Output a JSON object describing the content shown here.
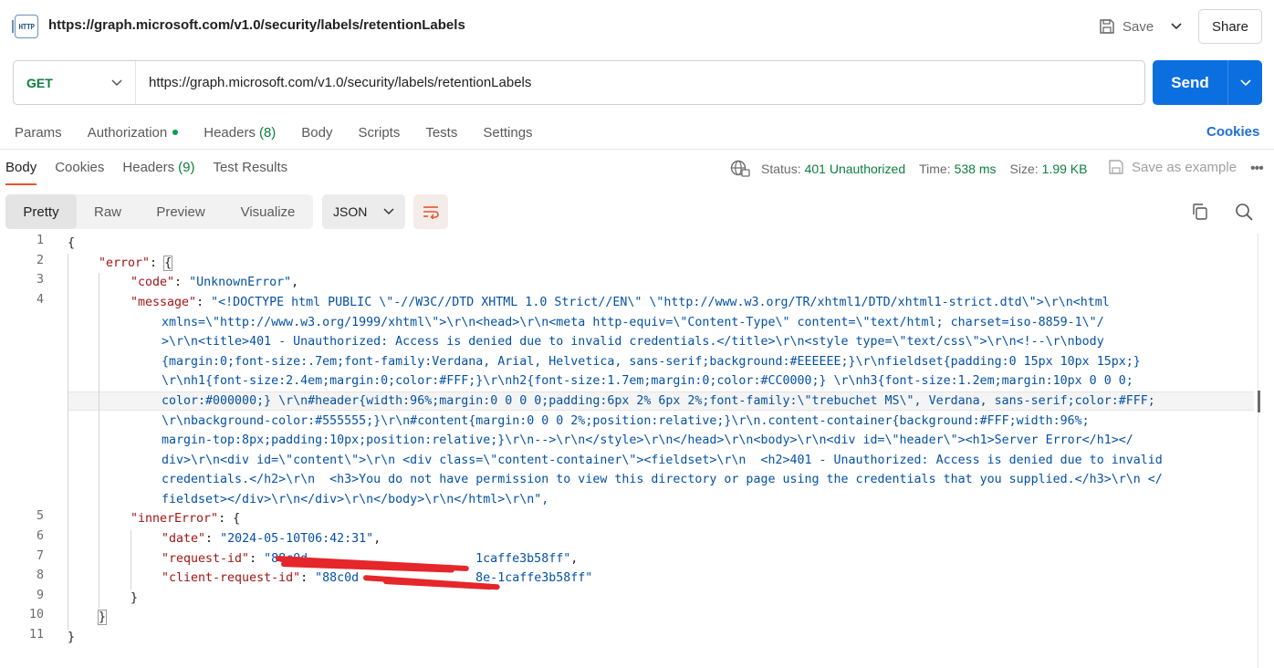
{
  "header": {
    "icon_label": "HTTP",
    "title": "https://graph.microsoft.com/v1.0/security/labels/retentionLabels",
    "save_label": "Save",
    "share_label": "Share"
  },
  "request": {
    "method": "GET",
    "url": "https://graph.microsoft.com/v1.0/security/labels/retentionLabels",
    "send_label": "Send"
  },
  "request_tabs": [
    {
      "label": "Params",
      "count": ""
    },
    {
      "label": "Authorization",
      "count": ""
    },
    {
      "label": "Headers",
      "count": "(8)"
    },
    {
      "label": "Body",
      "count": ""
    },
    {
      "label": "Scripts",
      "count": ""
    },
    {
      "label": "Tests",
      "count": ""
    },
    {
      "label": "Settings",
      "count": ""
    }
  ],
  "cookies_link": "Cookies",
  "response_tabs": [
    {
      "label": "Body",
      "count": ""
    },
    {
      "label": "Cookies",
      "count": ""
    },
    {
      "label": "Headers",
      "count": "(9)"
    },
    {
      "label": "Test Results",
      "count": ""
    }
  ],
  "status": {
    "status_label": "Status:",
    "status_value": "401 Unauthorized",
    "time_label": "Time:",
    "time_value": "538 ms",
    "size_label": "Size:",
    "size_value": "1.99 KB",
    "save_example_label": "Save as example"
  },
  "view_modes": [
    "Pretty",
    "Raw",
    "Preview",
    "Visualize"
  ],
  "active_view": "Pretty",
  "format": "JSON",
  "colors": {
    "accent": "#0b6fe0",
    "status_ok": "#0c7e3e",
    "active_tab_underline": "#e8552f",
    "json_key": "#a31515",
    "json_string": "#0451a5",
    "redaction": "#e5262a"
  },
  "line_numbers": [
    "1",
    "2",
    "3",
    "4",
    "5",
    "6",
    "7",
    "8",
    "9",
    "10",
    "11"
  ],
  "code": {
    "open_brace": "{",
    "error_key": "\"error\"",
    "code_key": "\"code\"",
    "code_value": "\"UnknownError\"",
    "message_key": "\"message\"",
    "message_lines": [
      "\"<!DOCTYPE html PUBLIC \\\"-//W3C//DTD XHTML 1.0 Strict//EN\\\" \\\"http://www.w3.org/TR/xhtml1/DTD/xhtml1-strict.dtd\\\">\\r\\n<html",
      "xmlns=\\\"http://www.w3.org/1999/xhtml\\\">\\r\\n<head>\\r\\n<meta http-equiv=\\\"Content-Type\\\" content=\\\"text/html; charset=iso-8859-1\\\"/",
      ">\\r\\n<title>401 - Unauthorized: Access is denied due to invalid credentials.</title>\\r\\n<style type=\\\"text/css\\\">\\r\\n<!--\\r\\nbody",
      "{margin:0;font-size:.7em;font-family:Verdana, Arial, Helvetica, sans-serif;background:#EEEEEE;}\\r\\nfieldset{padding:0 15px 10px 15px;}",
      "\\r\\nh1{font-size:2.4em;margin:0;color:#FFF;}\\r\\nh2{font-size:1.7em;margin:0;color:#CC0000;} \\r\\nh3{font-size:1.2em;margin:10px 0 0 0;",
      "color:#000000;} \\r\\n#header{width:96%;margin:0 0 0 0;padding:6px 2% 6px 2%;font-family:\\\"trebuchet MS\\\", Verdana, sans-serif;color:#FFF;",
      "\\r\\nbackground-color:#555555;}\\r\\n#content{margin:0 0 0 2%;position:relative;}\\r\\n.content-container{background:#FFF;width:96%;",
      "margin-top:8px;padding:10px;position:relative;}\\r\\n-->\\r\\n</style>\\r\\n</head>\\r\\n<body>\\r\\n<div id=\\\"header\\\"><h1>Server Error</h1></",
      "div>\\r\\n<div id=\\\"content\\\">\\r\\n <div class=\\\"content-container\\\"><fieldset>\\r\\n  <h2>401 - Unauthorized: Access is denied due to invalid",
      "credentials.</h2>\\r\\n  <h3>You do not have permission to view this directory or page using the credentials that you supplied.</h3>\\r\\n </",
      "fieldset></div>\\r\\n</div>\\r\\n</body>\\r\\n</html>\\r\\n\","
    ],
    "inner_error_key": "\"innerError\"",
    "date_key": "\"date\"",
    "date_value": "\"2024-05-10T06:42:31\"",
    "request_id_key": "\"request-id\"",
    "request_id_value_start": "\"88c0d",
    "request_id_value_end": "1caffe3b58ff\"",
    "client_request_id_key": "\"client-request-id\"",
    "client_request_id_value_start": "\"88c0d",
    "client_request_id_value_end": "8e-1caffe3b58ff\"",
    "close_inner": "}",
    "close_error": "}",
    "close_root": "}"
  }
}
